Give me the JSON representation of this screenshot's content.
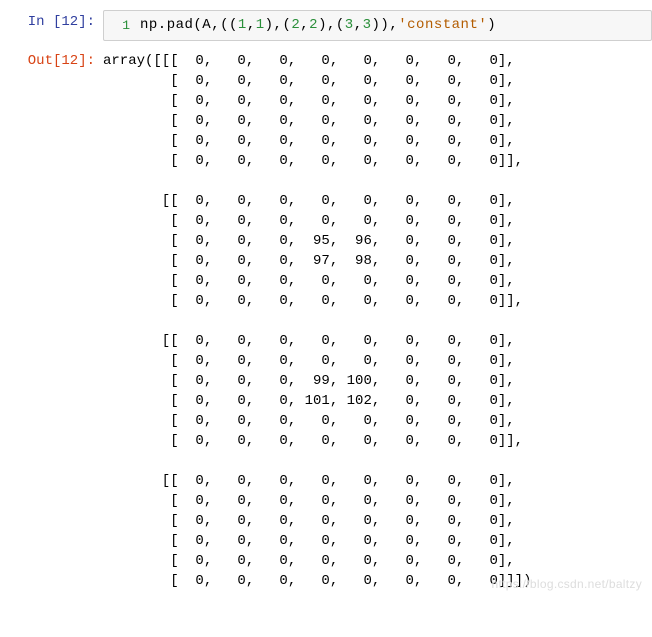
{
  "in_prompt": "In [12]:",
  "out_prompt": "Out[12]:",
  "line_number": "1",
  "code": {
    "t1": "np.pad(A,((",
    "n1": "1",
    "c1": ",",
    "n2": "1",
    "t2": "),(",
    "n3": "2",
    "c2": ",",
    "n4": "2",
    "t3": "),(",
    "n5": "3",
    "c3": ",",
    "n6": "3",
    "t4": ")),",
    "s1": "'constant'",
    "t5": ")"
  },
  "output_text": "array([[[  0,   0,   0,   0,   0,   0,   0,   0],\n        [  0,   0,   0,   0,   0,   0,   0,   0],\n        [  0,   0,   0,   0,   0,   0,   0,   0],\n        [  0,   0,   0,   0,   0,   0,   0,   0],\n        [  0,   0,   0,   0,   0,   0,   0,   0],\n        [  0,   0,   0,   0,   0,   0,   0,   0]],\n\n       [[  0,   0,   0,   0,   0,   0,   0,   0],\n        [  0,   0,   0,   0,   0,   0,   0,   0],\n        [  0,   0,   0,  95,  96,   0,   0,   0],\n        [  0,   0,   0,  97,  98,   0,   0,   0],\n        [  0,   0,   0,   0,   0,   0,   0,   0],\n        [  0,   0,   0,   0,   0,   0,   0,   0]],\n\n       [[  0,   0,   0,   0,   0,   0,   0,   0],\n        [  0,   0,   0,   0,   0,   0,   0,   0],\n        [  0,   0,   0,  99, 100,   0,   0,   0],\n        [  0,   0,   0, 101, 102,   0,   0,   0],\n        [  0,   0,   0,   0,   0,   0,   0,   0],\n        [  0,   0,   0,   0,   0,   0,   0,   0]],\n\n       [[  0,   0,   0,   0,   0,   0,   0,   0],\n        [  0,   0,   0,   0,   0,   0,   0,   0],\n        [  0,   0,   0,   0,   0,   0,   0,   0],\n        [  0,   0,   0,   0,   0,   0,   0,   0],\n        [  0,   0,   0,   0,   0,   0,   0,   0],\n        [  0,   0,   0,   0,   0,   0,   0,   0]]])",
  "watermark": "https://blog.csdn.net/baltzy",
  "chart_data": {
    "type": "table",
    "description": "NumPy 3D array output of np.pad with shape (4,6,8), padding ((1,1),(2,2),(3,3)) in constant mode",
    "original_values": [
      [
        95,
        96
      ],
      [
        97,
        98
      ],
      [
        99,
        100
      ],
      [
        101,
        102
      ]
    ],
    "padded_shape": [
      4,
      6,
      8
    ],
    "blocks": [
      [
        [
          0,
          0,
          0,
          0,
          0,
          0,
          0,
          0
        ],
        [
          0,
          0,
          0,
          0,
          0,
          0,
          0,
          0
        ],
        [
          0,
          0,
          0,
          0,
          0,
          0,
          0,
          0
        ],
        [
          0,
          0,
          0,
          0,
          0,
          0,
          0,
          0
        ],
        [
          0,
          0,
          0,
          0,
          0,
          0,
          0,
          0
        ],
        [
          0,
          0,
          0,
          0,
          0,
          0,
          0,
          0
        ]
      ],
      [
        [
          0,
          0,
          0,
          0,
          0,
          0,
          0,
          0
        ],
        [
          0,
          0,
          0,
          0,
          0,
          0,
          0,
          0
        ],
        [
          0,
          0,
          0,
          95,
          96,
          0,
          0,
          0
        ],
        [
          0,
          0,
          0,
          97,
          98,
          0,
          0,
          0
        ],
        [
          0,
          0,
          0,
          0,
          0,
          0,
          0,
          0
        ],
        [
          0,
          0,
          0,
          0,
          0,
          0,
          0,
          0
        ]
      ],
      [
        [
          0,
          0,
          0,
          0,
          0,
          0,
          0,
          0
        ],
        [
          0,
          0,
          0,
          0,
          0,
          0,
          0,
          0
        ],
        [
          0,
          0,
          0,
          99,
          100,
          0,
          0,
          0
        ],
        [
          0,
          0,
          0,
          101,
          102,
          0,
          0,
          0
        ],
        [
          0,
          0,
          0,
          0,
          0,
          0,
          0,
          0
        ],
        [
          0,
          0,
          0,
          0,
          0,
          0,
          0,
          0
        ]
      ],
      [
        [
          0,
          0,
          0,
          0,
          0,
          0,
          0,
          0
        ],
        [
          0,
          0,
          0,
          0,
          0,
          0,
          0,
          0
        ],
        [
          0,
          0,
          0,
          0,
          0,
          0,
          0,
          0
        ],
        [
          0,
          0,
          0,
          0,
          0,
          0,
          0,
          0
        ],
        [
          0,
          0,
          0,
          0,
          0,
          0,
          0,
          0
        ],
        [
          0,
          0,
          0,
          0,
          0,
          0,
          0,
          0
        ]
      ]
    ]
  }
}
